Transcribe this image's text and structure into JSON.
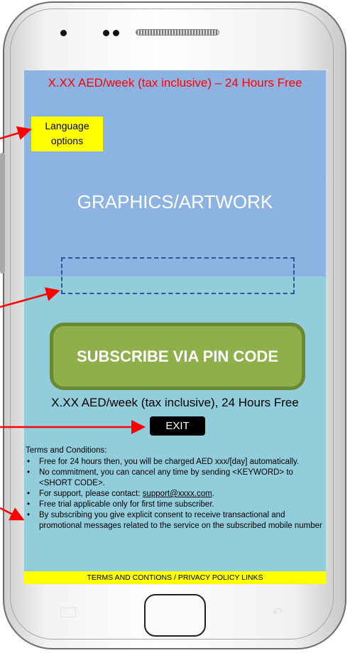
{
  "screen": {
    "top_price_banner": "X.XX AED/week (tax inclusive) – 24 Hours Free",
    "language_options_label": "Language options",
    "graphics_label": "GRAPHICS/ARTWORK",
    "subscribe_button_label": "SUBSCRIBE VIA PIN CODE",
    "price_line": "X.XX AED/week (tax inclusive), 24 Hours Free",
    "exit_button_label": "EXIT",
    "terms": {
      "heading": "Terms and Conditions:",
      "item_1": "Free for 24 hours then, you will be charged AED xxx/[day] automatically.",
      "item_2": "No commitment, you can cancel any time by sending <KEYWORD> to <SHORT CODE>.",
      "item_3_prefix": "For support, please contact: ",
      "item_3_link": "support@xxxx.com",
      "item_3_suffix": ".",
      "item_4": "Free trial applicable only for first time subscriber.",
      "item_5": "By subscribing you give explicit consent to receive transactional and promotional messages related to the service on the subscribed mobile number"
    },
    "links_bar": "TERMS AND CONTIONS / PRIVACY POLICY LINKS"
  },
  "colors": {
    "screen_top": "#8db3e2",
    "screen_bottom": "#92cddc",
    "price_banner_text": "#ff0000",
    "language_box": "#ffff00",
    "subscribe_button": "#8faf4a",
    "subscribe_border": "#6b8934",
    "pin_box_border": "#2f5597",
    "links_bar": "#ffff00",
    "annotation_arrow": "#ff0000"
  },
  "icons": {
    "camera": "camera-dot",
    "speaker": "speaker-grill",
    "menu": "menu-icon",
    "back": "back-arrow-icon",
    "home": "home-button"
  }
}
